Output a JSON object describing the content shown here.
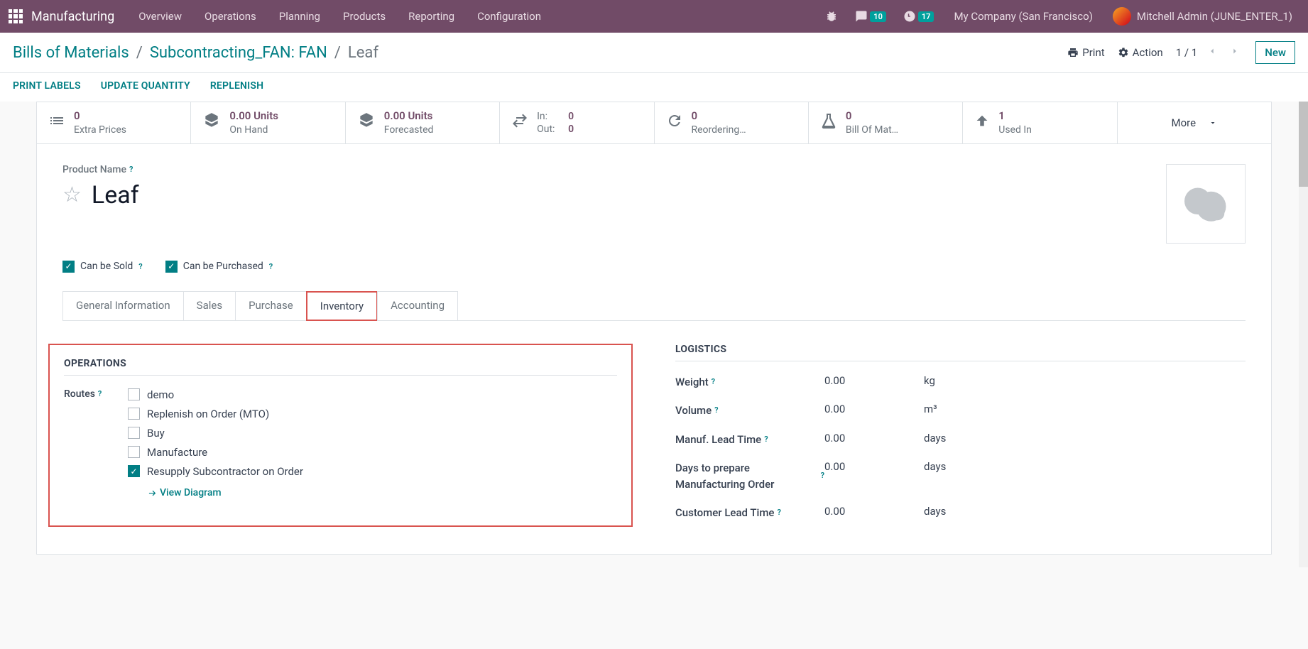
{
  "topnav": {
    "app": "Manufacturing",
    "items": [
      "Overview",
      "Operations",
      "Planning",
      "Products",
      "Reporting",
      "Configuration"
    ],
    "messages_badge": "10",
    "activities_badge": "17",
    "company": "My Company (San Francisco)",
    "user": "Mitchell Admin (JUNE_ENTER_1)"
  },
  "breadcrumb": {
    "a": "Bills of Materials",
    "b": "Subcontracting_FAN: FAN",
    "c": "Leaf",
    "print": "Print",
    "action": "Action",
    "pager": "1 / 1",
    "new": "New"
  },
  "actions": {
    "print_labels": "PRINT LABELS",
    "update_qty": "UPDATE QUANTITY",
    "replenish": "REPLENISH"
  },
  "stats": {
    "extra_prices": {
      "val": "0",
      "label": "Extra Prices"
    },
    "on_hand": {
      "val": "0.00 Units",
      "label": "On Hand"
    },
    "forecasted": {
      "val": "0.00 Units",
      "label": "Forecasted"
    },
    "in": {
      "label": "In:",
      "val": "0"
    },
    "out": {
      "label": "Out:",
      "val": "0"
    },
    "reordering": {
      "val": "0",
      "label": "Reordering…"
    },
    "bom": {
      "val": "0",
      "label": "Bill Of Mat…"
    },
    "used_in": {
      "val": "1",
      "label": "Used In"
    },
    "more": "More"
  },
  "product": {
    "name_label": "Product Name",
    "name": "Leaf",
    "can_sold": "Can be Sold",
    "can_purchased": "Can be Purchased"
  },
  "tabs": [
    "General Information",
    "Sales",
    "Purchase",
    "Inventory",
    "Accounting"
  ],
  "operations": {
    "title": "OPERATIONS",
    "routes_label": "Routes",
    "routes": [
      {
        "label": "demo",
        "checked": false
      },
      {
        "label": "Replenish on Order (MTO)",
        "checked": false
      },
      {
        "label": "Buy",
        "checked": false
      },
      {
        "label": "Manufacture",
        "checked": false
      },
      {
        "label": "Resupply Subcontractor on Order",
        "checked": true
      }
    ],
    "view_diagram": "View Diagram"
  },
  "logistics": {
    "title": "LOGISTICS",
    "rows": [
      {
        "label": "Weight",
        "val": "0.00",
        "unit": "kg",
        "help": true
      },
      {
        "label": "Volume",
        "val": "0.00",
        "unit": "m³",
        "help": true
      },
      {
        "label": "Manuf. Lead Time",
        "val": "0.00",
        "unit": "days",
        "help": true
      },
      {
        "label": "Days to prepare Manufacturing Order",
        "val": "0.00",
        "unit": "days",
        "help": true
      },
      {
        "label": "Customer Lead Time",
        "val": "0.00",
        "unit": "days",
        "help": true
      }
    ]
  }
}
